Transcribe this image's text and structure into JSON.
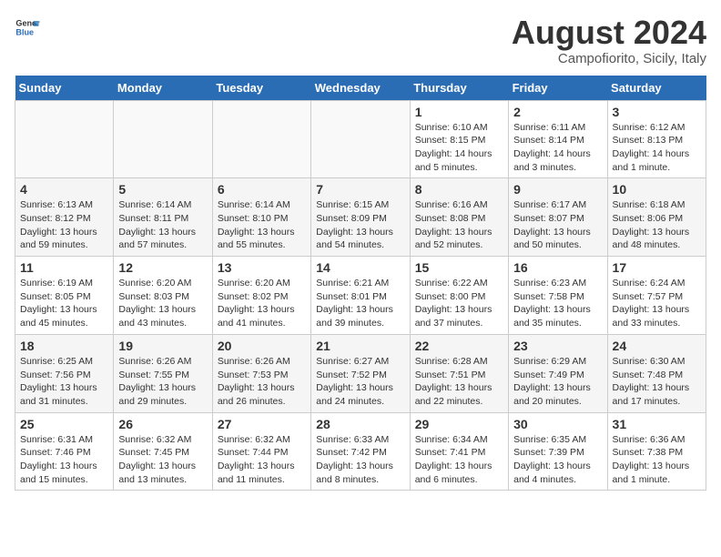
{
  "header": {
    "logo_line1": "General",
    "logo_line2": "Blue",
    "month": "August 2024",
    "location": "Campofiorito, Sicily, Italy"
  },
  "days_of_week": [
    "Sunday",
    "Monday",
    "Tuesday",
    "Wednesday",
    "Thursday",
    "Friday",
    "Saturday"
  ],
  "weeks": [
    [
      {
        "day": "",
        "info": ""
      },
      {
        "day": "",
        "info": ""
      },
      {
        "day": "",
        "info": ""
      },
      {
        "day": "",
        "info": ""
      },
      {
        "day": "1",
        "info": "Sunrise: 6:10 AM\nSunset: 8:15 PM\nDaylight: 14 hours\nand 5 minutes."
      },
      {
        "day": "2",
        "info": "Sunrise: 6:11 AM\nSunset: 8:14 PM\nDaylight: 14 hours\nand 3 minutes."
      },
      {
        "day": "3",
        "info": "Sunrise: 6:12 AM\nSunset: 8:13 PM\nDaylight: 14 hours\nand 1 minute."
      }
    ],
    [
      {
        "day": "4",
        "info": "Sunrise: 6:13 AM\nSunset: 8:12 PM\nDaylight: 13 hours\nand 59 minutes."
      },
      {
        "day": "5",
        "info": "Sunrise: 6:14 AM\nSunset: 8:11 PM\nDaylight: 13 hours\nand 57 minutes."
      },
      {
        "day": "6",
        "info": "Sunrise: 6:14 AM\nSunset: 8:10 PM\nDaylight: 13 hours\nand 55 minutes."
      },
      {
        "day": "7",
        "info": "Sunrise: 6:15 AM\nSunset: 8:09 PM\nDaylight: 13 hours\nand 54 minutes."
      },
      {
        "day": "8",
        "info": "Sunrise: 6:16 AM\nSunset: 8:08 PM\nDaylight: 13 hours\nand 52 minutes."
      },
      {
        "day": "9",
        "info": "Sunrise: 6:17 AM\nSunset: 8:07 PM\nDaylight: 13 hours\nand 50 minutes."
      },
      {
        "day": "10",
        "info": "Sunrise: 6:18 AM\nSunset: 8:06 PM\nDaylight: 13 hours\nand 48 minutes."
      }
    ],
    [
      {
        "day": "11",
        "info": "Sunrise: 6:19 AM\nSunset: 8:05 PM\nDaylight: 13 hours\nand 45 minutes."
      },
      {
        "day": "12",
        "info": "Sunrise: 6:20 AM\nSunset: 8:03 PM\nDaylight: 13 hours\nand 43 minutes."
      },
      {
        "day": "13",
        "info": "Sunrise: 6:20 AM\nSunset: 8:02 PM\nDaylight: 13 hours\nand 41 minutes."
      },
      {
        "day": "14",
        "info": "Sunrise: 6:21 AM\nSunset: 8:01 PM\nDaylight: 13 hours\nand 39 minutes."
      },
      {
        "day": "15",
        "info": "Sunrise: 6:22 AM\nSunset: 8:00 PM\nDaylight: 13 hours\nand 37 minutes."
      },
      {
        "day": "16",
        "info": "Sunrise: 6:23 AM\nSunset: 7:58 PM\nDaylight: 13 hours\nand 35 minutes."
      },
      {
        "day": "17",
        "info": "Sunrise: 6:24 AM\nSunset: 7:57 PM\nDaylight: 13 hours\nand 33 minutes."
      }
    ],
    [
      {
        "day": "18",
        "info": "Sunrise: 6:25 AM\nSunset: 7:56 PM\nDaylight: 13 hours\nand 31 minutes."
      },
      {
        "day": "19",
        "info": "Sunrise: 6:26 AM\nSunset: 7:55 PM\nDaylight: 13 hours\nand 29 minutes."
      },
      {
        "day": "20",
        "info": "Sunrise: 6:26 AM\nSunset: 7:53 PM\nDaylight: 13 hours\nand 26 minutes."
      },
      {
        "day": "21",
        "info": "Sunrise: 6:27 AM\nSunset: 7:52 PM\nDaylight: 13 hours\nand 24 minutes."
      },
      {
        "day": "22",
        "info": "Sunrise: 6:28 AM\nSunset: 7:51 PM\nDaylight: 13 hours\nand 22 minutes."
      },
      {
        "day": "23",
        "info": "Sunrise: 6:29 AM\nSunset: 7:49 PM\nDaylight: 13 hours\nand 20 minutes."
      },
      {
        "day": "24",
        "info": "Sunrise: 6:30 AM\nSunset: 7:48 PM\nDaylight: 13 hours\nand 17 minutes."
      }
    ],
    [
      {
        "day": "25",
        "info": "Sunrise: 6:31 AM\nSunset: 7:46 PM\nDaylight: 13 hours\nand 15 minutes."
      },
      {
        "day": "26",
        "info": "Sunrise: 6:32 AM\nSunset: 7:45 PM\nDaylight: 13 hours\nand 13 minutes."
      },
      {
        "day": "27",
        "info": "Sunrise: 6:32 AM\nSunset: 7:44 PM\nDaylight: 13 hours\nand 11 minutes."
      },
      {
        "day": "28",
        "info": "Sunrise: 6:33 AM\nSunset: 7:42 PM\nDaylight: 13 hours\nand 8 minutes."
      },
      {
        "day": "29",
        "info": "Sunrise: 6:34 AM\nSunset: 7:41 PM\nDaylight: 13 hours\nand 6 minutes."
      },
      {
        "day": "30",
        "info": "Sunrise: 6:35 AM\nSunset: 7:39 PM\nDaylight: 13 hours\nand 4 minutes."
      },
      {
        "day": "31",
        "info": "Sunrise: 6:36 AM\nSunset: 7:38 PM\nDaylight: 13 hours\nand 1 minute."
      }
    ]
  ]
}
